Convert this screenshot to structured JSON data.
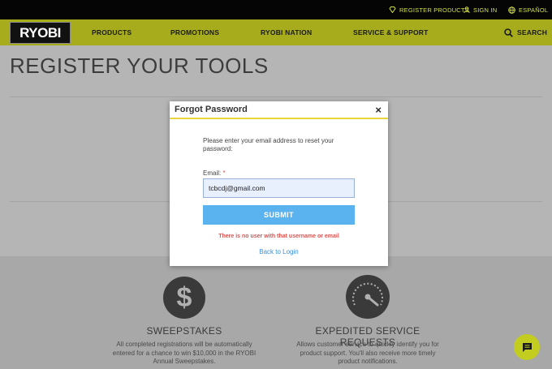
{
  "utility_bar": {
    "register": "REGISTER PRODUCTS",
    "sign_in": "SIGN IN",
    "language": "ESPAÑOL"
  },
  "nav": {
    "logo": "RYOBI",
    "products": "PRODUCTS",
    "promotions": "PROMOTIONS",
    "nation": "RYOBI NATION",
    "service": "SERVICE & SUPPORT",
    "search": "SEARCH"
  },
  "page": {
    "title": "REGISTER YOUR TOOLS"
  },
  "benefits": [
    {
      "icon": "dollar-icon",
      "title": "SWEEPSTAKES",
      "text": [
        "All completed registrations will be automatically",
        "entered for a chance to win $10,000 in the RYOBI",
        "Annual Sweepstakes."
      ]
    },
    {
      "icon": "speedometer-icon",
      "title": "EXPEDITED SERVICE REQUESTS",
      "text": [
        "Allows customer service to quickly identify you for",
        "product support. You'll also receive more timely",
        "product notifications."
      ]
    }
  ],
  "modal": {
    "title": "Forgot Password",
    "close": "×",
    "instructions": "Please enter your email address to reset your password:",
    "email_label": "Email:",
    "required_mark": "*",
    "email_value": "tcbcdj@gmail.com",
    "submit": "SUBMIT",
    "error": "There is no user with that username or email",
    "back_link": "Back to Login"
  },
  "colors": {
    "brand_yellow": "#c8d319",
    "submit_blue": "#5ab3ee",
    "error_red": "#d9534f",
    "link_blue": "#3a8fd6"
  }
}
